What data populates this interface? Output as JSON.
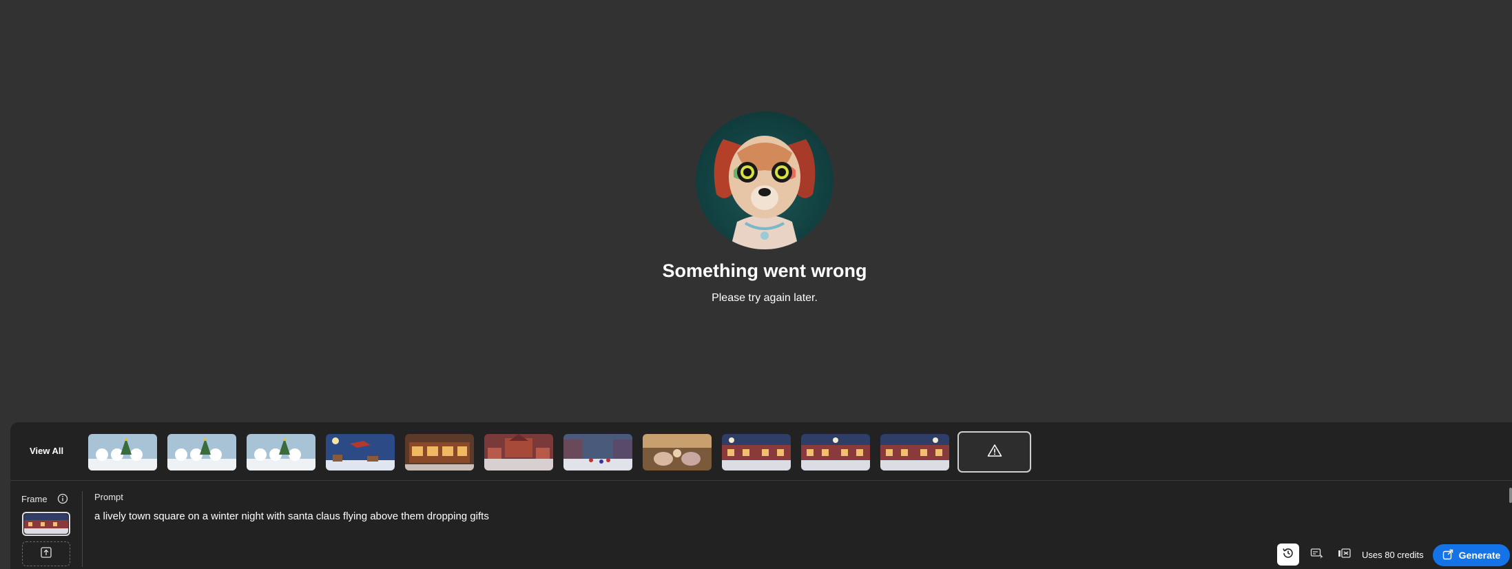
{
  "error": {
    "title": "Something went wrong",
    "message": "Please try again later."
  },
  "strip": {
    "view_all_label": "View All",
    "thumbnails": [
      {
        "theme": "snowmen-christmas-tree"
      },
      {
        "theme": "snowmen-christmas-tree"
      },
      {
        "theme": "snowmen-christmas-tree"
      },
      {
        "theme": "santa-sleigh-night-sky"
      },
      {
        "theme": "festive-storefront"
      },
      {
        "theme": "town-square-christmas"
      },
      {
        "theme": "snowy-street-crowd"
      },
      {
        "theme": "cozy-living-room"
      },
      {
        "theme": "town-square-night"
      },
      {
        "theme": "town-square-night"
      },
      {
        "theme": "town-square-night"
      }
    ],
    "warning_icon": "warning-triangle-icon"
  },
  "frame": {
    "label": "Frame"
  },
  "prompt": {
    "label": "Prompt",
    "value": "a lively town square on a winter night with santa claus flying above them dropping gifts"
  },
  "footer": {
    "credits_label": "Uses 80 credits",
    "generate_label": "Generate"
  },
  "colors": {
    "background": "#323232",
    "panel": "#222222",
    "accent": "#1473e6"
  }
}
